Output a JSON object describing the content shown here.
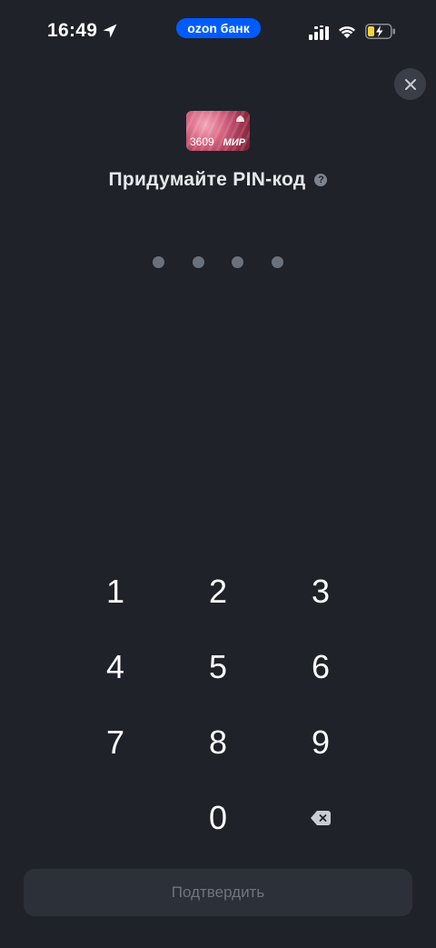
{
  "status_bar": {
    "time": "16:49",
    "app_pill": "ozon банк",
    "icons": [
      "location-arrow-icon",
      "cellular-signal-icon",
      "wifi-icon",
      "battery-charging-icon"
    ],
    "colors": {
      "app_pill": "#005bff",
      "battery": "#f5d33a"
    }
  },
  "card": {
    "number": "3609",
    "brand": "МИР"
  },
  "header": {
    "title": "Придумайте PIN-код",
    "help_icon": "?"
  },
  "pin": {
    "length": 4,
    "entered": 0
  },
  "keypad": {
    "keys": [
      "1",
      "2",
      "3",
      "4",
      "5",
      "6",
      "7",
      "8",
      "9",
      "0"
    ],
    "backspace_icon": "backspace-icon"
  },
  "footer": {
    "confirm_label": "Подтвердить",
    "confirm_enabled": false
  },
  "theme": {
    "background": "#1f2229",
    "dot_color": "#6b717b",
    "button_bg": "#2c3038"
  }
}
